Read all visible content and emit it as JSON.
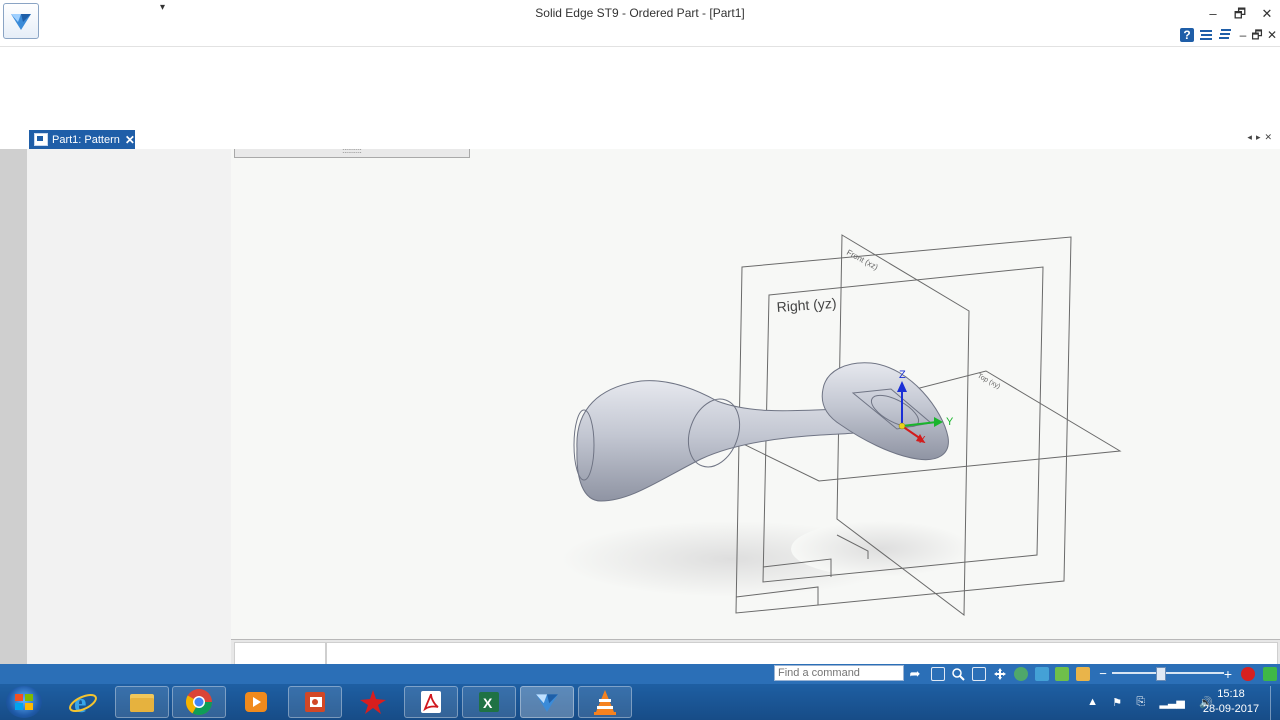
{
  "window": {
    "title": "Solid Edge ST9 - Ordered Part - [Part1]"
  },
  "qat": {
    "dropdown_glyph": "▾"
  },
  "window_controls": {
    "minimize": "–",
    "restore": "🗗",
    "close": "✕"
  },
  "ribbon_controls": {
    "help": "?",
    "minimize": "–",
    "restore": "🗗",
    "close": "✕"
  },
  "document_tab": {
    "label": "Part1: Pattern",
    "close": "✕"
  },
  "tab_nav": {
    "glyphs": "◂▸✕"
  },
  "resizer": {
    "grip": "::::::::::"
  },
  "viewport": {
    "plane_labels": {
      "front": "Front (xz)",
      "right": "Right (yz)",
      "top": "Top (xy)"
    },
    "axes": {
      "x": "X",
      "y": "Y",
      "z": "Z"
    }
  },
  "statusbar": {
    "command_finder_placeholder": "Find a command",
    "zoom_minus": "−",
    "zoom_plus": "+"
  },
  "taskbar": {
    "apps": [
      "internet-explorer",
      "file-explorer",
      "chrome",
      "media-player",
      "powerpoint",
      "red-app",
      "adobe-reader",
      "excel",
      "solid-edge",
      "vlc"
    ]
  },
  "clock": {
    "time": "15:18",
    "date": "28-09-2017"
  },
  "colors": {
    "accent": "#1f5ea8",
    "statusbar": "#2b6fb7",
    "taskbar": "#1a5595",
    "model": "#c9cdd8"
  }
}
